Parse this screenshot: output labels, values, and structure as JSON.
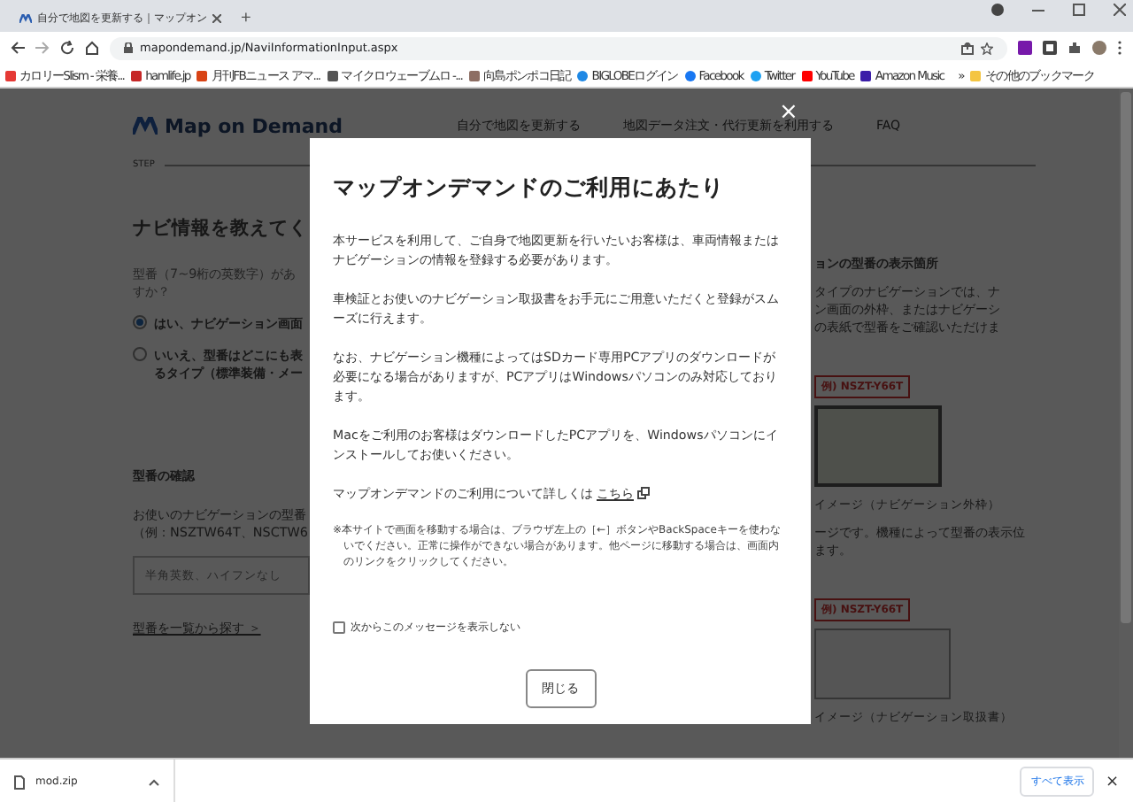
{
  "browser": {
    "tab_title": "自分で地図を更新する｜マップオン",
    "new_tab": "+",
    "url": "mapondemand.jp/NaviInformationInput.aspx",
    "bookmarks": [
      {
        "label": "カロリーSlism - 栄養..."
      },
      {
        "label": "hamlife.jp"
      },
      {
        "label": "月刊FBニュース アマ..."
      },
      {
        "label": "マイクロウェーブムロ -..."
      },
      {
        "label": "向島ポンポコ日記"
      },
      {
        "label": "BIGLOBEログイン"
      },
      {
        "label": "Facebook"
      },
      {
        "label": "Twitter"
      },
      {
        "label": "YouTube"
      },
      {
        "label": "Amazon Music"
      }
    ],
    "more_bookmarks": "»",
    "other_bookmarks": "その他のブックマーク"
  },
  "page": {
    "logo": "Map on Demand",
    "nav": [
      "自分で地図を更新する",
      "地図データ注文・代行更新を利用する",
      "FAQ"
    ],
    "step_label": "STEP",
    "heading": "ナビ情報を教えてく",
    "question": [
      "型番（7~9桁の英数字）があ",
      "すか？"
    ],
    "options": [
      {
        "lines": [
          "はい、ナビゲーション画面"
        ],
        "selected": true
      },
      {
        "lines": [
          "いいえ、型番はどこにも表",
          "るタイプ（標準装備・メー"
        ],
        "selected": false
      }
    ],
    "model_heading": "型番の確認",
    "model_desc": [
      "お使いのナビゲーションの型番",
      "（例：NSZTW64T、NSCTW6"
    ],
    "model_input": {
      "placeholder": "半角英数、ハイフンなし"
    },
    "model_link": "型番を一覧から探す ＞",
    "side_heading": "ョンの型番の表示箇所",
    "side_text": [
      "タイプのナビゲーションでは、ナ",
      "ン画面の外枠、またはナビゲーシ",
      "の表紙で型番をご確認いただけま"
    ],
    "callout_1": "例) NSZT-Y66T",
    "caption_1": "イメージ（ナビゲーション外枠）",
    "side_note": [
      "ージです。機種によって型番の表示位",
      "ます。"
    ],
    "callout_2": "例) NSZT-Y66T",
    "caption_2": "イメージ（ナビゲーション取扱書）"
  },
  "modal": {
    "close": "×",
    "title": "マップオンデマンドのご利用にあたり",
    "paragraphs": [
      "本サービスを利用して、ご自身で地図更新を行いたいお客様は、車両情報またはナビゲーションの情報を登録する必要があります。",
      "車検証とお使いのナビゲーション取扱書をお手元にご用意いただくと登録がスムーズに行えます。",
      "なお、ナビゲーション機種によってはSDカード専用PCアプリのダウンロードが必要になる場合がありますが、PCアプリはWindowsパソコンのみ対応しております。",
      "Macをご利用のお客様はダウンロードしたPCアプリを、Windowsパソコンにインストールしてお使いください。"
    ],
    "more_text": "マップオンデマンドのご利用について詳しくは",
    "more_link": "こちら",
    "note": "※本サイトで画面を移動する場合は、ブラウザ左上の［←］ボタンやBackSpaceキーを使わないでください。正常に操作ができない場合があります。他ページに移動する場合は、画面内のリンクをクリックしてください。",
    "dont_show": {
      "label": "次からこのメッセージを表示しない",
      "checked": false
    },
    "button": "閉じる"
  },
  "downloads": {
    "file": "mod.zip",
    "show_all": "すべて表示",
    "close": "×"
  }
}
